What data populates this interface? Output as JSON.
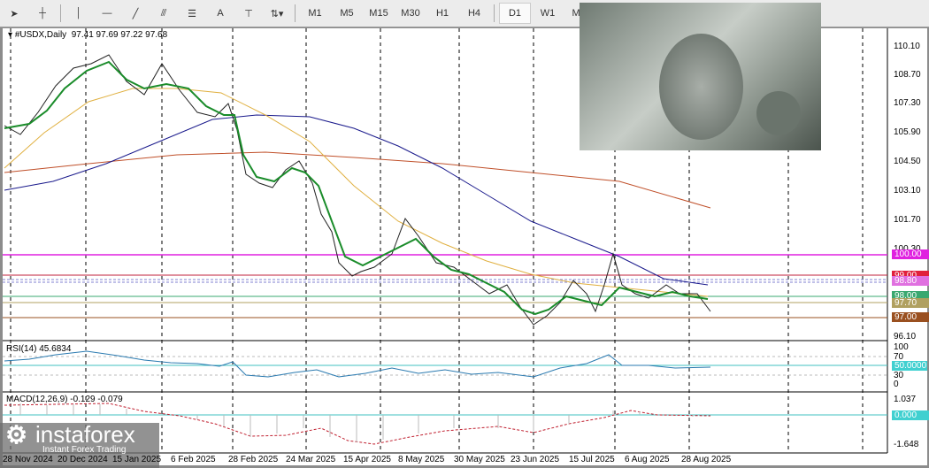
{
  "toolbar": {
    "tools": [
      "cursor",
      "crosshair",
      "vertical-line",
      "horizontal-line",
      "trendline",
      "fibo-channel",
      "fibo-retracement",
      "text",
      "text-label",
      "arrows"
    ],
    "text_label": "A",
    "timeframes": [
      "M1",
      "M5",
      "M15",
      "M30",
      "H1",
      "H4",
      "D1",
      "W1",
      "MN"
    ],
    "active_timeframe": "D1"
  },
  "chart": {
    "title": "#USDX,Daily",
    "ohlc": "97.41 97.69 97.22 97.68",
    "price_ticks": [
      "110.10",
      "108.70",
      "107.30",
      "105.90",
      "104.50",
      "103.10",
      "101.70",
      "100.30",
      "96.10"
    ],
    "levels": [
      {
        "label": "100.00",
        "color": "#e020e0"
      },
      {
        "label": "99.00",
        "color": "#e0203c"
      },
      {
        "label": "98.80",
        "color": "#e070e0"
      },
      {
        "label": "98.00",
        "color": "#3aa870"
      },
      {
        "label": "97.70",
        "color": "#b0a060"
      },
      {
        "label": "97.00",
        "color": "#9a5020"
      }
    ],
    "dates": [
      "28 Nov 2024",
      "20 Dec 2024",
      "15 Jan 2025",
      "6 Feb 2025",
      "28 Feb 2025",
      "24 Mar 2025",
      "15 Apr 2025",
      "8 May 2025",
      "30 May 2025",
      "23 Jun 2025",
      "15 Jul 2025",
      "6 Aug 2025",
      "28 Aug 2025"
    ]
  },
  "rsi": {
    "label": "RSI(14) 45.6834",
    "ticks": [
      "100",
      "70",
      "30",
      "0"
    ],
    "level": "50.0000"
  },
  "macd": {
    "label": "MACD(12,26,9) -0.129 -0.079",
    "ticks": [
      "1.037",
      "-1.648"
    ],
    "level": "0.000"
  },
  "logo": {
    "name": "instaforex",
    "tagline": "Instant Forex Trading"
  }
}
